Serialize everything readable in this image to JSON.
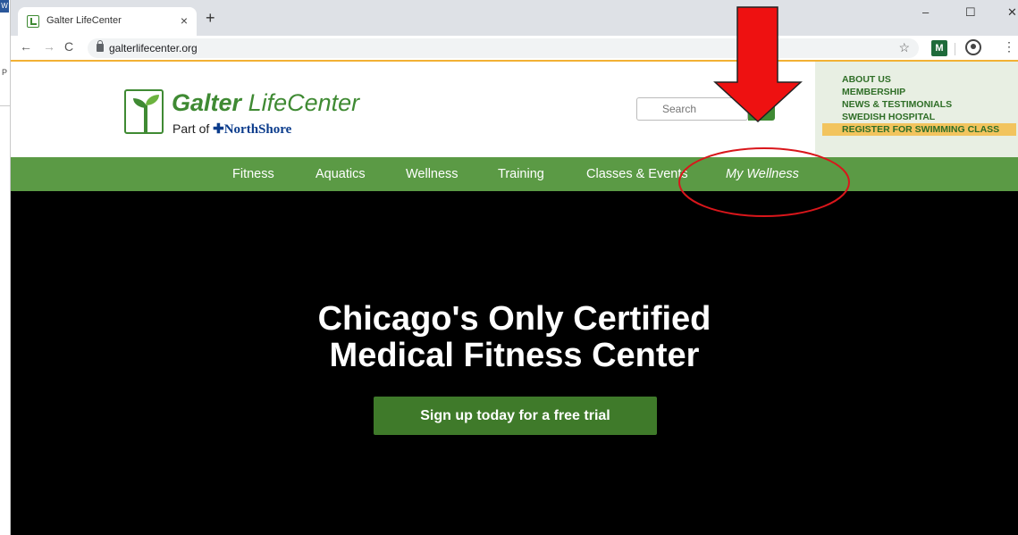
{
  "browser": {
    "tab_title": "Galter LifeCenter",
    "tab_close": "×",
    "new_tab": "+",
    "url": "galterlifecenter.org",
    "window_minimize": "–",
    "window_maximize": "☐",
    "window_close": "✕",
    "ext_label": "M"
  },
  "site": {
    "logo_bold": "Galter",
    "logo_rest": "LifeCenter",
    "logo_part_of": "Part of",
    "logo_northshore": "NorthShore",
    "search_placeholder": "Search",
    "util_links": [
      "ABOUT US",
      "MEMBERSHIP",
      "NEWS & TESTIMONIALS",
      "SWEDISH HOSPITAL",
      "REGISTER FOR SWIMMING CLASS"
    ],
    "nav": [
      "Fitness",
      "Aquatics",
      "Wellness",
      "Training",
      "Classes & Events",
      "My Wellness"
    ],
    "hero_line1": "Chicago's Only Certified",
    "hero_line2": "Medical Fitness Center",
    "hero_cta": "Sign up today for a free trial"
  },
  "annotation": {
    "arrow_color": "#ee1111",
    "circle_color": "#d9161b"
  },
  "colors": {
    "brand_green": "#3f8a33",
    "nav_green": "#5b9a45",
    "highlight": "#f2c45e"
  }
}
